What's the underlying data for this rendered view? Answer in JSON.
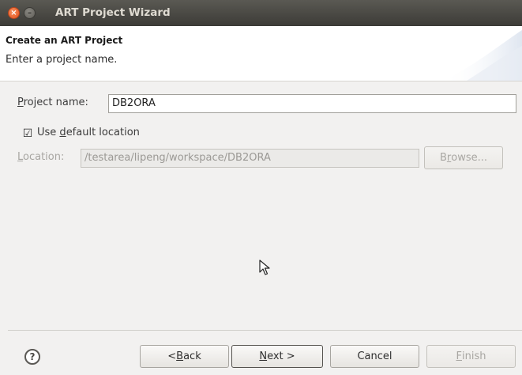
{
  "window": {
    "title": "ART Project Wizard",
    "close_glyph": "×",
    "min_glyph": "–"
  },
  "banner": {
    "title": "Create an ART Project",
    "description": "Enter a project name."
  },
  "form": {
    "project_name": {
      "label_pre": "",
      "label_mnemonic": "P",
      "label_post": "roject name:",
      "value": "DB2ORA"
    },
    "use_default": {
      "checked_glyph": "☑",
      "label_pre": "Use ",
      "label_mnemonic": "d",
      "label_post": "efault location",
      "checked": true
    },
    "location": {
      "label_pre": "",
      "label_mnemonic": "L",
      "label_post": "ocation:",
      "value": "/testarea/lipeng/workspace/DB2ORA",
      "disabled": true
    },
    "browse": {
      "label_pre": "B",
      "label_mnemonic": "r",
      "label_post": "owse..."
    }
  },
  "footer": {
    "help_glyph": "?",
    "back": {
      "label_pre": "< ",
      "label_mnemonic": "B",
      "label_post": "ack"
    },
    "next": {
      "label_pre": "",
      "label_mnemonic": "N",
      "label_post": "ext >"
    },
    "cancel": {
      "label": "Cancel"
    },
    "finish": {
      "label_pre": "",
      "label_mnemonic": "F",
      "label_post": "inish"
    }
  },
  "icons": {
    "close": "close-icon",
    "minimize": "minimize-icon",
    "help": "help-icon",
    "cursor": "mouse-pointer-icon",
    "checkbox": "checkbox-checked-icon"
  },
  "colors": {
    "titlebar": "#3c3b37",
    "close_button": "#e4521d",
    "window_bg": "#f2f1f0",
    "banner_bg": "#ffffff"
  }
}
